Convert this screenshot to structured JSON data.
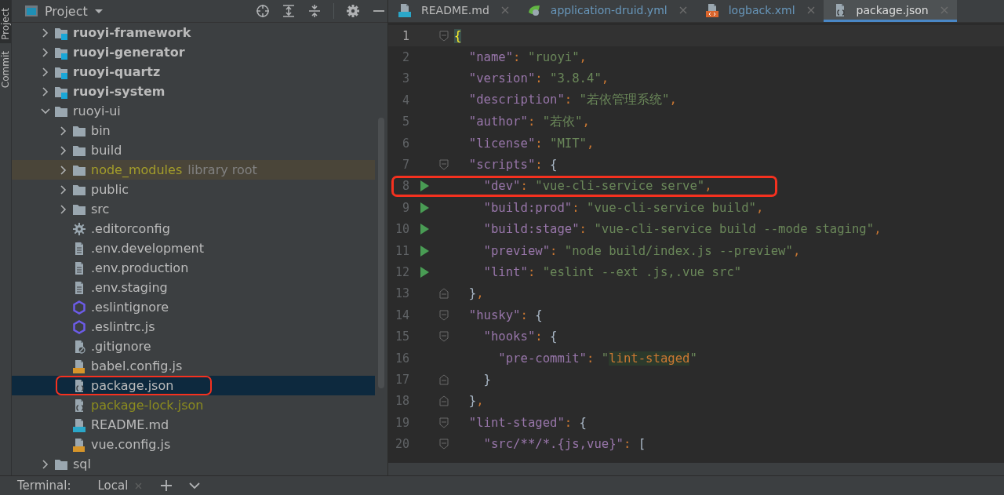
{
  "side_strip": {
    "tabs": [
      {
        "label": "Project",
        "selected": true
      },
      {
        "label": "Commit",
        "selected": false
      }
    ]
  },
  "project_panel": {
    "title": "Project",
    "tree": [
      {
        "label": "ruoyi-framework",
        "kind": "module",
        "expanded": false,
        "selected": false,
        "shaded": false,
        "annotated": false
      },
      {
        "label": "ruoyi-generator",
        "kind": "module",
        "expanded": false,
        "selected": false,
        "shaded": false,
        "annotated": false
      },
      {
        "label": "ruoyi-quartz",
        "kind": "module",
        "expanded": false,
        "selected": false,
        "shaded": false,
        "annotated": false
      },
      {
        "label": "ruoyi-system",
        "kind": "module",
        "expanded": false,
        "selected": false,
        "shaded": false,
        "annotated": false
      },
      {
        "label": "ruoyi-ui",
        "kind": "folder",
        "expanded": true,
        "selected": false,
        "shaded": false,
        "annotated": false,
        "children": [
          {
            "label": "bin",
            "kind": "folder",
            "expanded": false,
            "selected": false,
            "shaded": false,
            "annotated": false
          },
          {
            "label": "build",
            "kind": "folder",
            "expanded": false,
            "selected": false,
            "shaded": false,
            "annotated": false
          },
          {
            "label": "node_modules",
            "hint": "library root",
            "kind": "folder",
            "expanded": false,
            "selected": false,
            "shaded": true,
            "annotated": false,
            "color": "#a39d2b"
          },
          {
            "label": "public",
            "kind": "folder",
            "expanded": false,
            "selected": false,
            "shaded": false,
            "annotated": false
          },
          {
            "label": "src",
            "kind": "folder",
            "expanded": false,
            "selected": false,
            "shaded": false,
            "annotated": false
          },
          {
            "label": ".editorconfig",
            "kind": "gear",
            "selected": false,
            "shaded": false,
            "annotated": false
          },
          {
            "label": ".env.development",
            "kind": "doc",
            "selected": false,
            "shaded": false,
            "annotated": false
          },
          {
            "label": ".env.production",
            "kind": "doc",
            "selected": false,
            "shaded": false,
            "annotated": false
          },
          {
            "label": ".env.staging",
            "kind": "doc",
            "selected": false,
            "shaded": false,
            "annotated": false
          },
          {
            "label": ".eslintignore",
            "kind": "eslint",
            "selected": false,
            "shaded": false,
            "annotated": false
          },
          {
            "label": ".eslintrc.js",
            "kind": "eslint",
            "selected": false,
            "shaded": false,
            "annotated": false
          },
          {
            "label": ".gitignore",
            "kind": "gitignore",
            "selected": false,
            "shaded": false,
            "annotated": false
          },
          {
            "label": "babel.config.js",
            "kind": "js",
            "selected": false,
            "shaded": false,
            "annotated": false
          },
          {
            "label": "package.json",
            "kind": "json",
            "selected": true,
            "shaded": false,
            "annotated": true
          },
          {
            "label": "package-lock.json",
            "kind": "json",
            "selected": false,
            "shaded": false,
            "annotated": false,
            "color": "#8c8c1f"
          },
          {
            "label": "README.md",
            "kind": "md",
            "selected": false,
            "shaded": false,
            "annotated": false
          },
          {
            "label": "vue.config.js",
            "kind": "js",
            "selected": false,
            "shaded": false,
            "annotated": false
          }
        ]
      },
      {
        "label": "sql",
        "kind": "folder",
        "expanded": false,
        "selected": false,
        "shaded": false,
        "annotated": false
      }
    ]
  },
  "editor": {
    "tabs": [
      {
        "label": "README.md",
        "kind": "md",
        "selected": false,
        "modified": false
      },
      {
        "label": "application-druid.yml",
        "kind": "leaf",
        "selected": false,
        "modified": true
      },
      {
        "label": "logback.xml",
        "kind": "xml",
        "selected": false,
        "modified": true
      },
      {
        "label": "package.json",
        "kind": "json",
        "selected": true,
        "modified": false
      }
    ],
    "lines": [
      {
        "number": "1",
        "current": true,
        "run": false,
        "annotated": false,
        "fold_open": true,
        "fold_close": false,
        "tokens": [
          {
            "kind": "match",
            "text": "{"
          }
        ]
      },
      {
        "number": "2",
        "current": false,
        "run": false,
        "annotated": false,
        "fold_open": false,
        "fold_close": false,
        "tokens": [
          {
            "kind": "key",
            "text": "  \"name\""
          },
          {
            "kind": "punct",
            "text": ": "
          },
          {
            "kind": "str",
            "text": "\"ruoyi\""
          },
          {
            "kind": "punct",
            "text": ","
          }
        ]
      },
      {
        "number": "3",
        "current": false,
        "run": false,
        "annotated": false,
        "fold_open": false,
        "fold_close": false,
        "tokens": [
          {
            "kind": "key",
            "text": "  \"version\""
          },
          {
            "kind": "punct",
            "text": ": "
          },
          {
            "kind": "str",
            "text": "\"3.8.4\""
          },
          {
            "kind": "punct",
            "text": ","
          }
        ]
      },
      {
        "number": "4",
        "current": false,
        "run": false,
        "annotated": false,
        "fold_open": false,
        "fold_close": false,
        "tokens": [
          {
            "kind": "key",
            "text": "  \"description\""
          },
          {
            "kind": "punct",
            "text": ": "
          },
          {
            "kind": "str",
            "text": "\"若依管理系统\""
          },
          {
            "kind": "punct",
            "text": ","
          }
        ]
      },
      {
        "number": "5",
        "current": false,
        "run": false,
        "annotated": false,
        "fold_open": false,
        "fold_close": false,
        "tokens": [
          {
            "kind": "key",
            "text": "  \"author\""
          },
          {
            "kind": "punct",
            "text": ": "
          },
          {
            "kind": "str",
            "text": "\"若依\""
          },
          {
            "kind": "punct",
            "text": ","
          }
        ]
      },
      {
        "number": "6",
        "current": false,
        "run": false,
        "annotated": false,
        "fold_open": false,
        "fold_close": false,
        "tokens": [
          {
            "kind": "key",
            "text": "  \"license\""
          },
          {
            "kind": "punct",
            "text": ": "
          },
          {
            "kind": "str",
            "text": "\"MIT\""
          },
          {
            "kind": "punct",
            "text": ","
          }
        ]
      },
      {
        "number": "7",
        "current": false,
        "run": false,
        "annotated": false,
        "fold_open": true,
        "fold_close": false,
        "tokens": [
          {
            "kind": "key",
            "text": "  \"scripts\""
          },
          {
            "kind": "punct",
            "text": ": "
          },
          {
            "kind": "brace",
            "text": "{"
          }
        ]
      },
      {
        "number": "8",
        "current": false,
        "run": true,
        "annotated": true,
        "fold_open": false,
        "fold_close": false,
        "tokens": [
          {
            "kind": "key",
            "text": "    \"dev\""
          },
          {
            "kind": "punct",
            "text": ": "
          },
          {
            "kind": "str",
            "text": "\"vue-cli-service serve\""
          },
          {
            "kind": "punct",
            "text": ","
          }
        ]
      },
      {
        "number": "9",
        "current": false,
        "run": true,
        "annotated": false,
        "fold_open": false,
        "fold_close": false,
        "tokens": [
          {
            "kind": "key",
            "text": "    \"build:prod\""
          },
          {
            "kind": "punct",
            "text": ": "
          },
          {
            "kind": "str",
            "text": "\"vue-cli-service build\""
          },
          {
            "kind": "punct",
            "text": ","
          }
        ]
      },
      {
        "number": "10",
        "current": false,
        "run": true,
        "annotated": false,
        "fold_open": false,
        "fold_close": false,
        "tokens": [
          {
            "kind": "key",
            "text": "    \"build:stage\""
          },
          {
            "kind": "punct",
            "text": ": "
          },
          {
            "kind": "str",
            "text": "\"vue-cli-service build --mode staging\""
          },
          {
            "kind": "punct",
            "text": ","
          }
        ]
      },
      {
        "number": "11",
        "current": false,
        "run": true,
        "annotated": false,
        "fold_open": false,
        "fold_close": false,
        "tokens": [
          {
            "kind": "key",
            "text": "    \"preview\""
          },
          {
            "kind": "punct",
            "text": ": "
          },
          {
            "kind": "str",
            "text": "\"node build/index.js --preview\""
          },
          {
            "kind": "punct",
            "text": ","
          }
        ]
      },
      {
        "number": "12",
        "current": false,
        "run": true,
        "annotated": false,
        "fold_open": false,
        "fold_close": false,
        "tokens": [
          {
            "kind": "key",
            "text": "    \"lint\""
          },
          {
            "kind": "punct",
            "text": ": "
          },
          {
            "kind": "str",
            "text": "\"eslint --ext .js,.vue src\""
          }
        ]
      },
      {
        "number": "13",
        "current": false,
        "run": false,
        "annotated": false,
        "fold_open": false,
        "fold_close": true,
        "tokens": [
          {
            "kind": "brace",
            "text": "  }"
          },
          {
            "kind": "punct",
            "text": ","
          }
        ]
      },
      {
        "number": "14",
        "current": false,
        "run": false,
        "annotated": false,
        "fold_open": true,
        "fold_close": false,
        "tokens": [
          {
            "kind": "key",
            "text": "  \"husky\""
          },
          {
            "kind": "punct",
            "text": ": "
          },
          {
            "kind": "brace",
            "text": "{"
          }
        ]
      },
      {
        "number": "15",
        "current": false,
        "run": false,
        "annotated": false,
        "fold_open": true,
        "fold_close": false,
        "tokens": [
          {
            "kind": "key",
            "text": "    \"hooks\""
          },
          {
            "kind": "punct",
            "text": ": "
          },
          {
            "kind": "brace",
            "text": "{"
          }
        ]
      },
      {
        "number": "16",
        "current": false,
        "run": false,
        "annotated": false,
        "fold_open": false,
        "fold_close": false,
        "tokens": [
          {
            "kind": "key",
            "text": "      \"pre-commit\""
          },
          {
            "kind": "punct",
            "text": ": "
          },
          {
            "kind": "str",
            "text": "\""
          },
          {
            "kind": "inject",
            "text": "lint-staged"
          },
          {
            "kind": "str",
            "text": "\""
          }
        ]
      },
      {
        "number": "17",
        "current": false,
        "run": false,
        "annotated": false,
        "fold_open": false,
        "fold_close": true,
        "tokens": [
          {
            "kind": "brace",
            "text": "    }"
          }
        ]
      },
      {
        "number": "18",
        "current": false,
        "run": false,
        "annotated": false,
        "fold_open": false,
        "fold_close": true,
        "tokens": [
          {
            "kind": "brace",
            "text": "  }"
          },
          {
            "kind": "punct",
            "text": ","
          }
        ]
      },
      {
        "number": "19",
        "current": false,
        "run": false,
        "annotated": false,
        "fold_open": true,
        "fold_close": false,
        "tokens": [
          {
            "kind": "key",
            "text": "  \"lint-staged\""
          },
          {
            "kind": "punct",
            "text": ": "
          },
          {
            "kind": "brace",
            "text": "{"
          }
        ]
      },
      {
        "number": "20",
        "current": false,
        "run": false,
        "annotated": false,
        "fold_open": true,
        "fold_close": false,
        "tokens": [
          {
            "kind": "key",
            "text": "    \"src/**/*.{js,vue}\""
          },
          {
            "kind": "punct",
            "text": ": "
          },
          {
            "kind": "brace",
            "text": "["
          }
        ]
      }
    ]
  },
  "terminal_bar": {
    "title": "Terminal:",
    "tabs": [
      {
        "label": "Local"
      }
    ]
  }
}
